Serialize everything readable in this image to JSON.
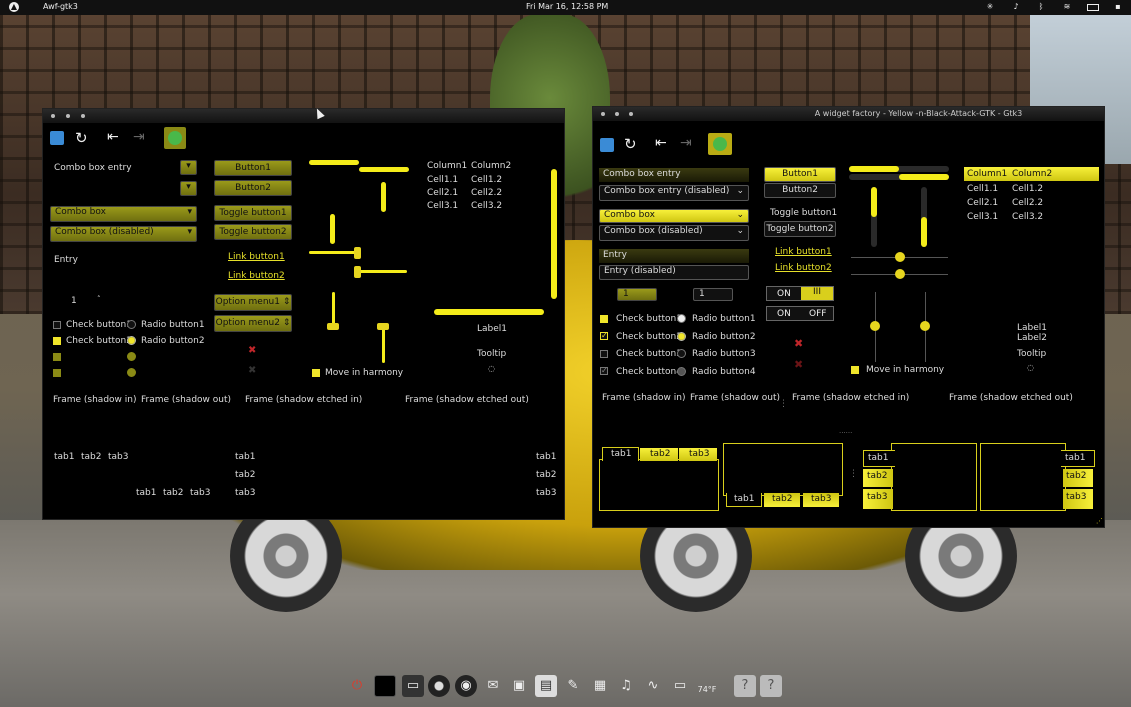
{
  "panel": {
    "app": "Awf-gtk3",
    "clock": "Fri Mar 16, 12:58 PM"
  },
  "left_window": {
    "combo_entry": "Combo box entry",
    "combo_box": "Combo box",
    "combo_disabled": "Combo box (disabled)",
    "entry": "Entry",
    "spin_value": "1",
    "check1": "Check button1",
    "check2": "Check button2",
    "radio1": "Radio button1",
    "radio2": "Radio button2",
    "button1": "Button1",
    "button2": "Button2",
    "toggle1": "Toggle button1",
    "toggle2": "Toggle button2",
    "link1": "Link button1",
    "link2": "Link button2",
    "option1": "Option menu1",
    "option2": "Option menu2",
    "harmony": "Move in harmony",
    "columns": [
      "Column1",
      "Column2"
    ],
    "cells": [
      [
        "Cell1.1",
        "Cell1.2"
      ],
      [
        "Cell2.1",
        "Cell2.2"
      ],
      [
        "Cell3.1",
        "Cell3.2"
      ]
    ],
    "label1": "Label1",
    "tooltip": "Tooltip",
    "frames": [
      "Frame (shadow in)",
      "Frame (shadow out)",
      "Frame (shadow etched in)",
      "Frame (shadow etched out)"
    ],
    "tabs": [
      "tab1",
      "tab2",
      "tab3"
    ]
  },
  "right_window": {
    "title": "A widget factory - Yellow -n-Black-Attack-GTK - Gtk3",
    "combo_entry": "Combo box entry",
    "combo_entry_disabled": "Combo box entry (disabled)",
    "combo_box": "Combo box",
    "combo_disabled": "Combo box (disabled)",
    "entry": "Entry",
    "entry_disabled": "Entry (disabled)",
    "spin1": "1",
    "spin2": "1",
    "switch_on": "ON",
    "switch_off": "OFF",
    "switch_bars": "III",
    "checks": [
      "Check button1",
      "Check button2",
      "Check button3",
      "Check button4"
    ],
    "radios": [
      "Radio button1",
      "Radio button2",
      "Radio button3",
      "Radio button4"
    ],
    "button1": "Button1",
    "button2": "Button2",
    "toggle1": "Toggle button1",
    "toggle2": "Toggle button2",
    "link1": "Link button1",
    "link2": "Link button2",
    "harmony": "Move in harmony",
    "columns": [
      "Column1",
      "Column2"
    ],
    "cells": [
      [
        "Cell1.1",
        "Cell1.2"
      ],
      [
        "Cell2.1",
        "Cell2.2"
      ],
      [
        "Cell3.1",
        "Cell3.2"
      ]
    ],
    "label1": "Label1",
    "label2": "Label2",
    "tooltip": "Tooltip",
    "frames": [
      "Frame (shadow in)",
      "Frame (shadow out)",
      "Frame (shadow etched in)",
      "Frame (shadow etched out)"
    ],
    "tabs": [
      "tab1",
      "tab2",
      "tab3"
    ]
  },
  "dock": {
    "weather": "74°F"
  }
}
